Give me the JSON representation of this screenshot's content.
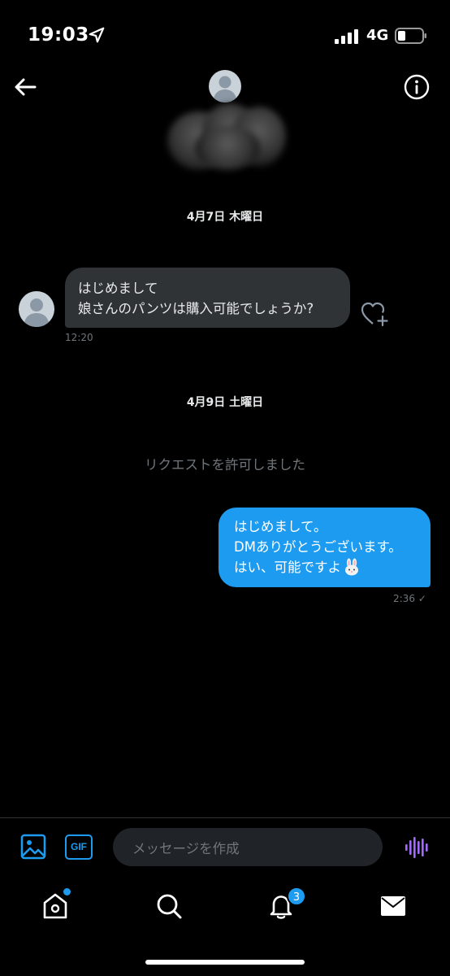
{
  "status_bar": {
    "time": "19:03",
    "network": "4G"
  },
  "conversation": {
    "date_1": "4月7日 木曜日",
    "incoming": {
      "line1": "はじめまして",
      "line2": "娘さんのパンツは購入可能でしょうか?",
      "time": "12:20"
    },
    "date_2": "4月9日 土曜日",
    "system_message": "リクエストを許可しました",
    "outgoing": {
      "line1": "はじめまして。",
      "line2": "DMありがとうございます。",
      "line3": "はい、可能ですよ",
      "time": "2:36 ✓"
    }
  },
  "composer": {
    "placeholder": "メッセージを作成",
    "gif_label": "GIF"
  },
  "bottom_nav": {
    "notifications_count": "3"
  },
  "colors": {
    "accent": "#1d9bf0",
    "bubble_in": "#2f3336",
    "muted": "#71767b",
    "voice": "#a26bfa"
  }
}
